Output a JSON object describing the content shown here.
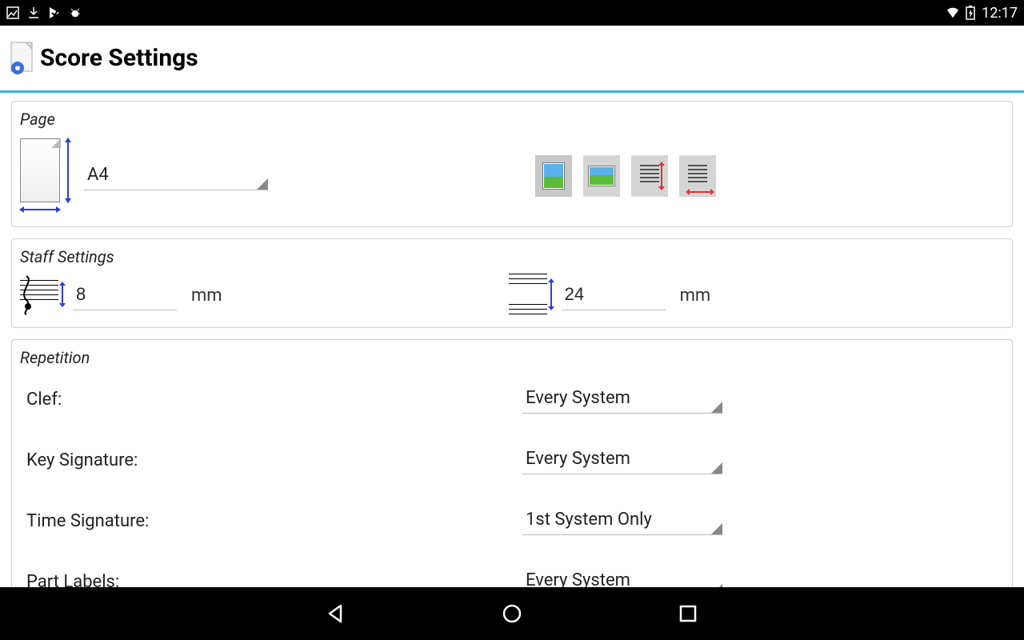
{
  "status": {
    "time": "12:17"
  },
  "app": {
    "title": "Score Settings"
  },
  "sections": {
    "page": {
      "title": "Page",
      "size_value": "A4"
    },
    "staff": {
      "title": "Staff Settings",
      "height_value": "8",
      "height_unit": "mm",
      "spacing_value": "24",
      "spacing_unit": "mm"
    },
    "repetition": {
      "title": "Repetition",
      "rows": [
        {
          "label": "Clef:",
          "value": "Every System"
        },
        {
          "label": "Key Signature:",
          "value": "Every System"
        },
        {
          "label": "Time Signature:",
          "value": "1st System Only"
        },
        {
          "label": "Part Labels:",
          "value": "Every System"
        }
      ]
    }
  }
}
